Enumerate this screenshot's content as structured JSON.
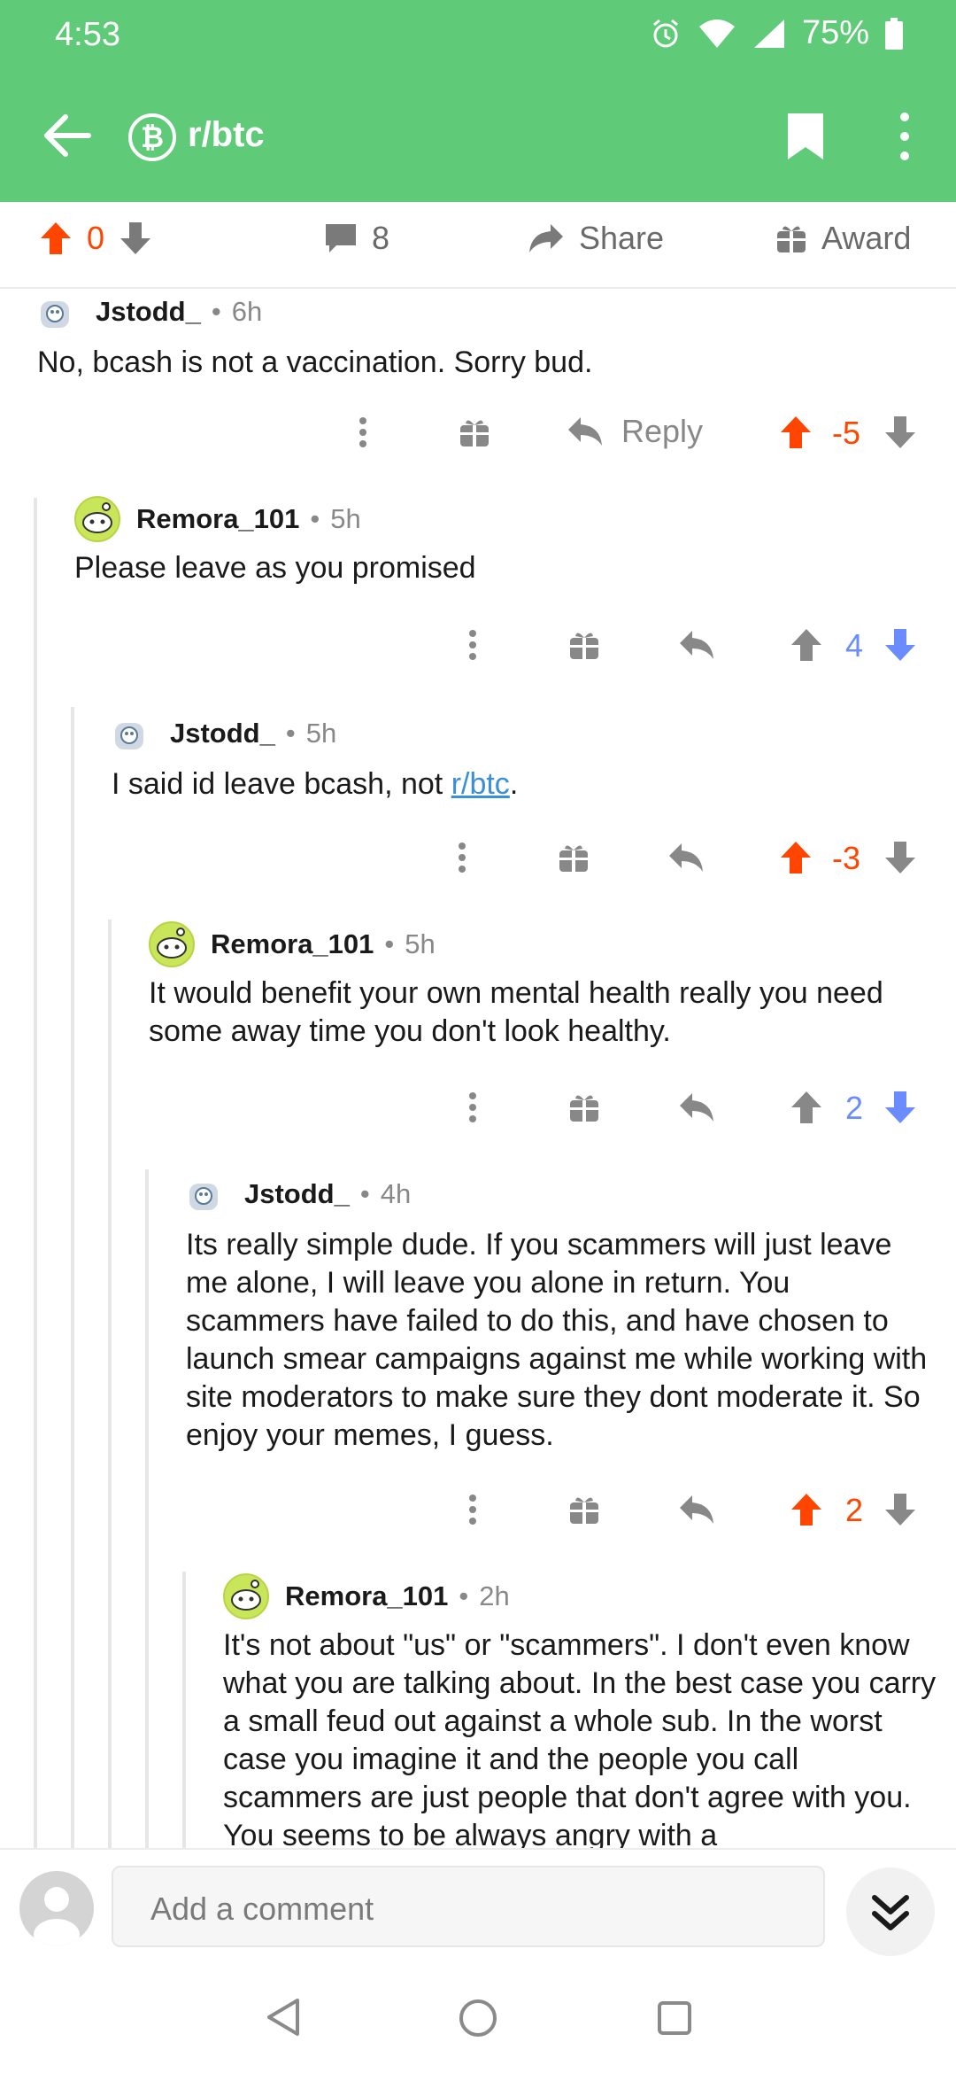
{
  "status_bar": {
    "time": "4:53",
    "battery": "75%"
  },
  "header": {
    "subreddit": "r/btc"
  },
  "post_actions": {
    "score": "0",
    "comments": "8",
    "share_label": "Share",
    "award_label": "Award"
  },
  "comments": [
    {
      "author": "Jstodd_",
      "age": "6h",
      "body": "No, bcash is not a vaccination. Sorry bud.",
      "reply_label": "Reply",
      "score": "-5"
    },
    {
      "author": "Remora_101",
      "age": "5h",
      "body": "Please leave as you promised",
      "score": "4"
    },
    {
      "author": "Jstodd_",
      "age": "5h",
      "body_prefix": "I said id leave bcash, not ",
      "body_link": "r/btc",
      "body_suffix": ".",
      "score": "-3"
    },
    {
      "author": "Remora_101",
      "age": "5h",
      "body": "It would benefit your own mental health really you need some away time you don't look healthy.",
      "score": "2"
    },
    {
      "author": "Jstodd_",
      "age": "4h",
      "body": "Its really simple dude. If you scammers will just leave me alone, I will leave you alone in return. You scammers have failed to do this, and have chosen to launch smear campaigns against me while working with site moderators to make sure they dont moderate it. So enjoy your memes, I guess.",
      "score": "2"
    },
    {
      "author": "Remora_101",
      "age": "2h",
      "body": "It's not about \"us\" or \"scammers\". I don't even know what you are talking about. In the best case you carry a small feud out against a whole sub. In the worst case you imagine it and the people you call scammers are just people that don't agree with you. You seems to be always angry with a"
    }
  ],
  "composer": {
    "placeholder": "Add a comment"
  },
  "colors": {
    "header_green": "#5fcb78",
    "upvote_orange": "#ff4500",
    "downvote_blue": "#6a8cff",
    "link_blue": "#3a8fd6"
  }
}
